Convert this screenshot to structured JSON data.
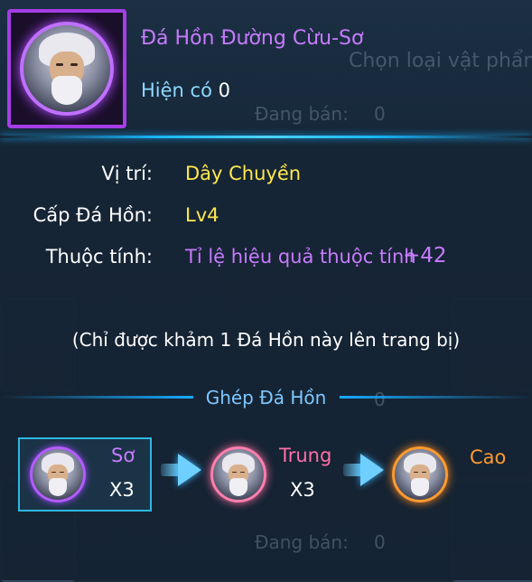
{
  "background": {
    "choose_item": "Chọn loại vật phẩm",
    "selling_label_1": "Đang bán:",
    "selling_count_1": "0",
    "selling_label_2": "Đang bán:",
    "selling_count_2": "0",
    "count_mid": "0"
  },
  "item": {
    "name": "Đá Hồn Đường Cừu-Sơ",
    "owned_label": "Hiện có",
    "owned_count": "0",
    "icon": "old-sage-portrait-icon",
    "frame_color": "#a53ee6"
  },
  "stats": {
    "position_label": "Vị trí:",
    "position_value": "Dây Chuyền",
    "level_label": "Cấp Đá Hồn:",
    "level_value": "Lv4",
    "attribute_label": "Thuộc tính:",
    "attribute_value": "Tỉ lệ hiệu quả thuộc tính",
    "attribute_bonus": "+42"
  },
  "note": "(Chỉ được khảm 1 Đá Hồn này lên trang bị)",
  "merge": {
    "title": "Ghép Đá Hồn",
    "stages": [
      {
        "grade": "Sơ",
        "count": "X3",
        "color": "#c77bff"
      },
      {
        "grade": "Trung",
        "count": "X3",
        "color": "#ff6fa8"
      },
      {
        "grade": "Cao",
        "color": "#ff9a2e"
      }
    ]
  },
  "colors": {
    "accent_blue": "#19b7ff",
    "name_purple": "#c77bff",
    "value_yellow": "#ffe94d"
  }
}
